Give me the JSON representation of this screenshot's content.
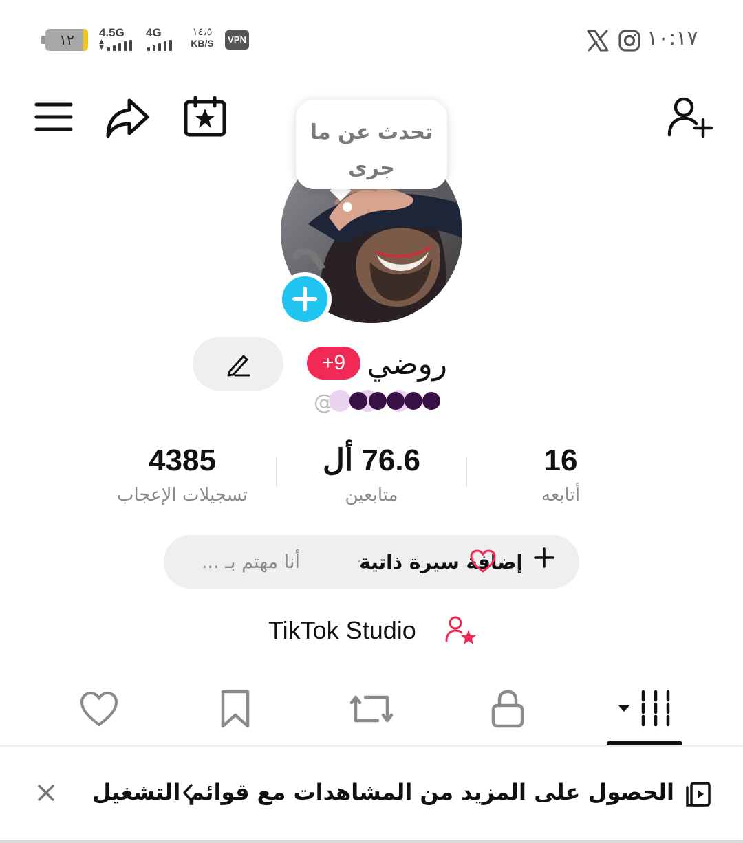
{
  "status_bar": {
    "battery_text": "١٢",
    "battery_level": 0.12,
    "network_1": "4.5G",
    "network_2": "4G",
    "speed_value": "١٤،٥",
    "speed_unit": "KB/S",
    "vpn": "VPN",
    "time": "١٠:١٧",
    "icons": [
      "x-logo-icon",
      "instagram-icon"
    ]
  },
  "top_nav": {
    "icons": [
      "menu-icon",
      "share-icon",
      "calendar-star-icon",
      "add-friend-icon"
    ]
  },
  "bubble": {
    "line1": "تحدث عن ما",
    "line2": "جرى"
  },
  "profile": {
    "name": "روضي",
    "badge": "+9",
    "username": "@"
  },
  "stats": [
    {
      "value": "16",
      "label": "أتابعه"
    },
    {
      "value": "76.6 أل",
      "label": "متابعين"
    },
    {
      "value": "4385",
      "label": "تسجيلات الإعجاب"
    }
  ],
  "bio": {
    "add_label": "إضافة سيرة ذاتية",
    "separator": "·",
    "interest_label": "أنا مهتم بـ ..."
  },
  "studio": {
    "label": "TikTok Studio"
  },
  "tabs": [
    {
      "name": "liked",
      "icon": "heart-icon"
    },
    {
      "name": "saved",
      "icon": "bookmark-icon"
    },
    {
      "name": "reposts",
      "icon": "repost-icon"
    },
    {
      "name": "private",
      "icon": "lock-icon"
    },
    {
      "name": "videos",
      "icon": "grid-icon",
      "selected": true
    }
  ],
  "banner": {
    "text": "الحصول على المزيد من المشاهدات مع قوائم التشغيل",
    "close": "×"
  },
  "colors": {
    "accent_red": "#f02a55",
    "accent_cyan": "#20c4f0",
    "pill_bg": "#efefef",
    "muted_text": "#8a8a8a"
  }
}
